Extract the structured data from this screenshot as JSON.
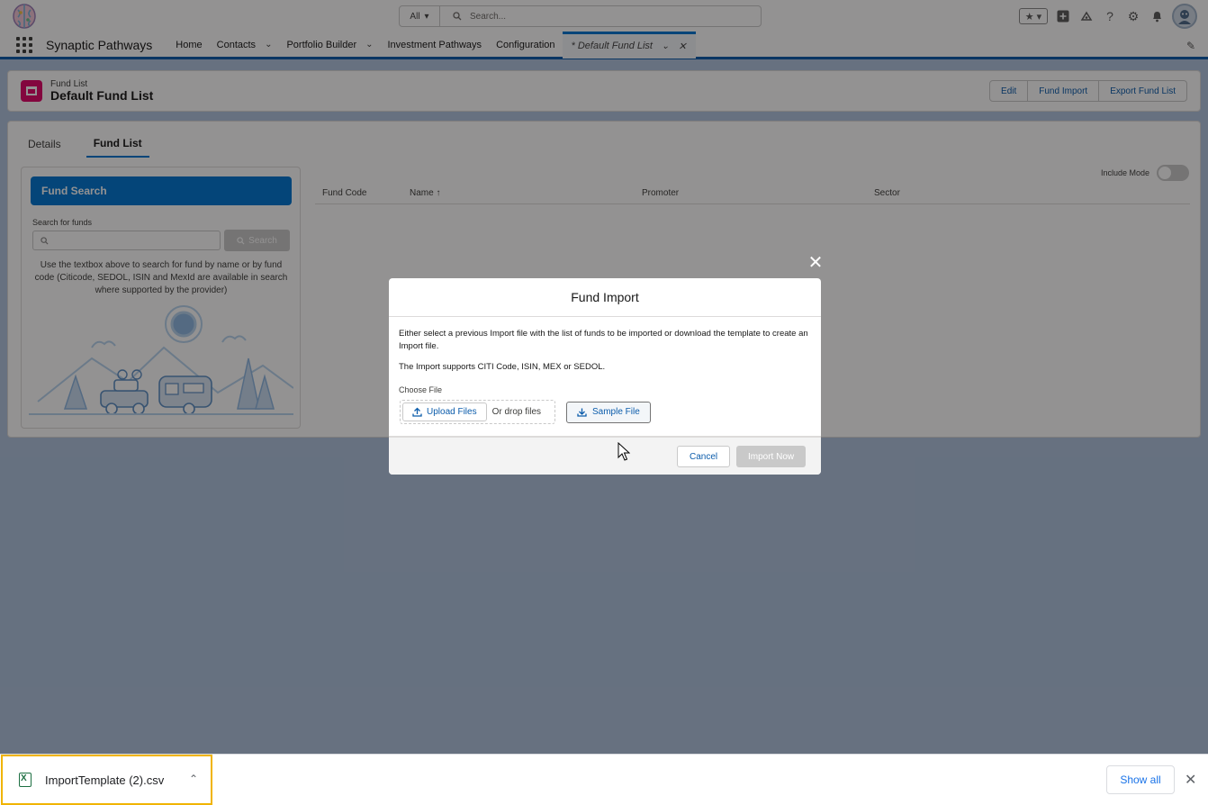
{
  "header": {
    "search_scope": "All",
    "search_placeholder": "Search...",
    "icons": [
      "favorites-icon",
      "add-icon",
      "trailhead-icon",
      "help-icon",
      "setup-gear-icon",
      "notifications-bell-icon",
      "avatar"
    ]
  },
  "nav": {
    "app_name": "Synaptic Pathways",
    "items": [
      {
        "label": "Home"
      },
      {
        "label": "Contacts"
      },
      {
        "label": "Portfolio Builder"
      },
      {
        "label": "Investment Pathways"
      },
      {
        "label": "Configuration"
      }
    ],
    "active_tab": "* Default Fund List"
  },
  "record": {
    "object_label": "Fund List",
    "title": "Default Fund List",
    "actions": [
      "Edit",
      "Fund Import",
      "Export Fund List"
    ]
  },
  "tabs": [
    "Details",
    "Fund List"
  ],
  "fund_search": {
    "header": "Fund Search",
    "label": "Search for funds",
    "button": "Search",
    "help": "Use the textbox above to search for fund by name or by fund code (Citicode, SEDOL, ISIN and MexId are available in search where supported by the provider)"
  },
  "include_mode_label": "Include Mode",
  "table": {
    "columns": [
      "Fund Code",
      "Name ↑",
      "Promoter",
      "Sector"
    ]
  },
  "modal": {
    "title": "Fund Import",
    "para1": "Either select a previous Import file with the list of funds to be imported or download the template to create an Import file.",
    "para2": "The Import supports CITI Code, ISIN, MEX or SEDOL.",
    "choose_label": "Choose File",
    "upload_label": "Upload Files",
    "drop_label": "Or drop files",
    "sample_label": "Sample File",
    "cancel_label": "Cancel",
    "import_label": "Import Now"
  },
  "downloads": {
    "file_name": "ImportTemplate (2).csv",
    "show_all": "Show all"
  },
  "colors": {
    "brand_blue": "#0176d3",
    "header_bg": "#b0c4df",
    "record_icon": "#e3066a",
    "download_highlight": "#f0b400"
  }
}
